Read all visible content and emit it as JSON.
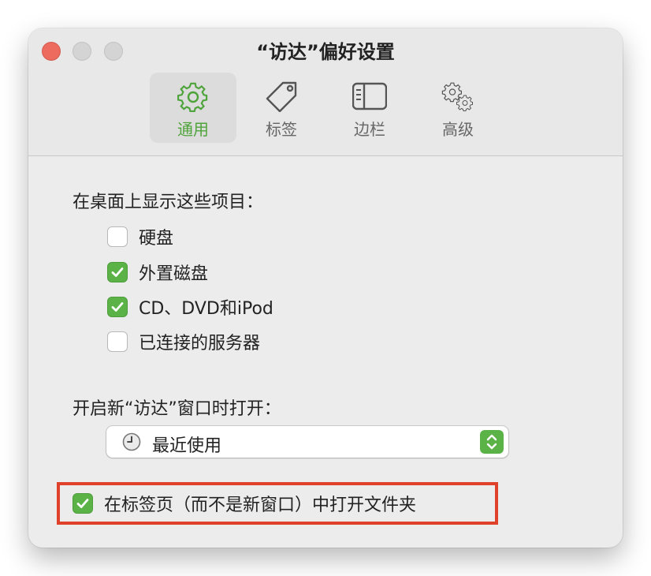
{
  "window": {
    "title": "“访达”偏好设置"
  },
  "toolbar": {
    "tabs": [
      {
        "label": "通用",
        "icon": "gear-icon",
        "active": true
      },
      {
        "label": "标签",
        "icon": "tag-icon",
        "active": false
      },
      {
        "label": "边栏",
        "icon": "sidebar-icon",
        "active": false
      },
      {
        "label": "高级",
        "icon": "gears-icon",
        "active": false
      }
    ]
  },
  "desktop": {
    "heading": "在桌面上显示这些项目：",
    "items": [
      {
        "label": "硬盘",
        "checked": false
      },
      {
        "label": "外置磁盘",
        "checked": true
      },
      {
        "label": "CD、DVD和iPod",
        "checked": true
      },
      {
        "label": "已连接的服务器",
        "checked": false
      }
    ]
  },
  "new_window": {
    "heading": "开启新“访达”窗口时打开：",
    "selected": "最近使用",
    "icon": "clock-icon"
  },
  "tabs_option": {
    "label": "在标签页（而不是新窗口）中打开文件夹",
    "checked": true
  },
  "colors": {
    "accent": "#5bb347",
    "highlight": "#e0412b",
    "close": "#ed6a5e"
  }
}
